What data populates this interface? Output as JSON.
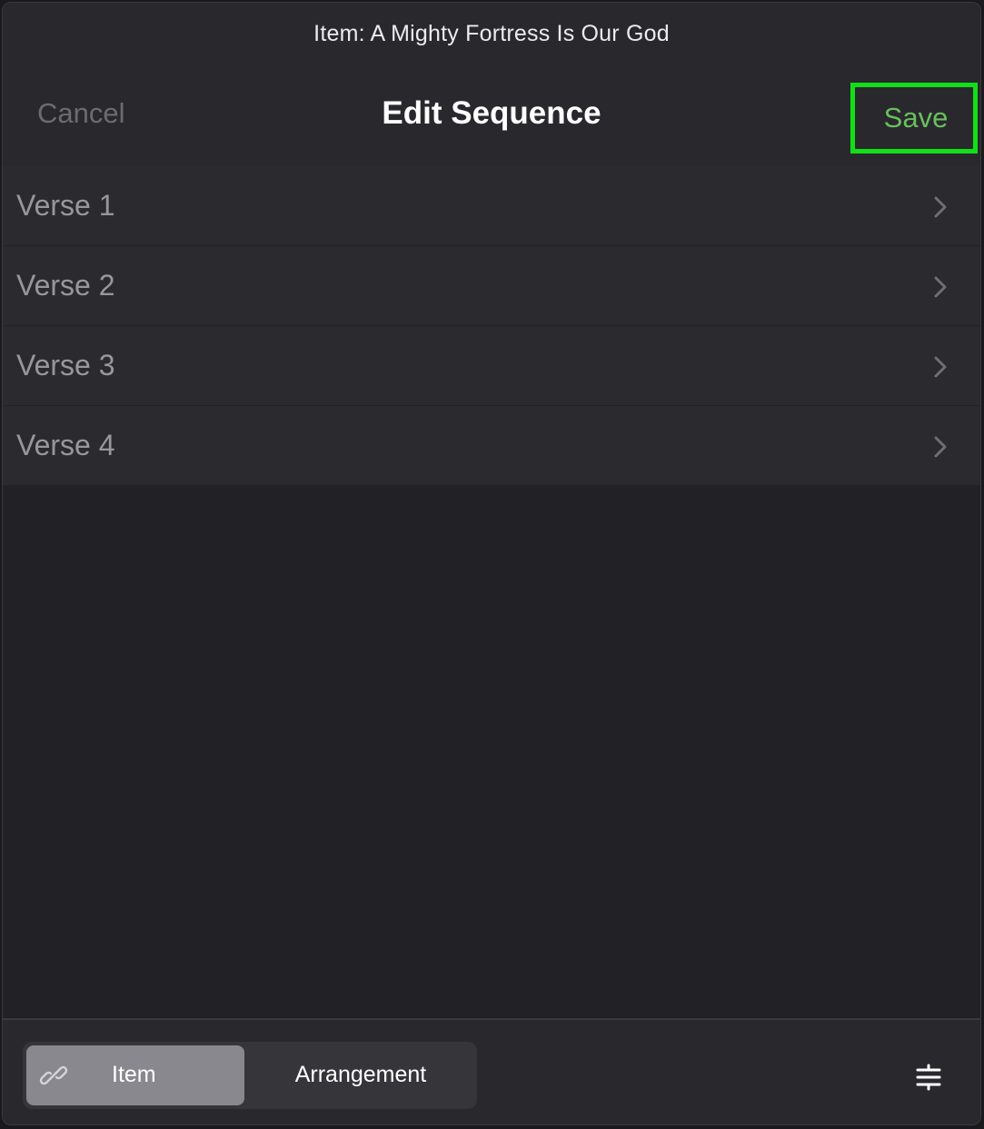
{
  "header": {
    "subtitle": "Item: A Mighty Fortress Is Our God",
    "title": "Edit Sequence",
    "cancel_label": "Cancel",
    "save_label": "Save"
  },
  "sections": [
    {
      "label": "Verse 1",
      "icon": "chevron-right-icon"
    },
    {
      "label": "Verse 2",
      "icon": "chevron-right-icon"
    },
    {
      "label": "Verse 3",
      "icon": "chevron-right-icon"
    },
    {
      "label": "Verse 4",
      "icon": "chevron-right-icon"
    }
  ],
  "bottom_bar": {
    "segments": [
      {
        "label": "Item",
        "icon": "link-icon",
        "selected": true
      },
      {
        "label": "Arrangement",
        "selected": false
      }
    ],
    "options_icon": "sliders-icon"
  },
  "colors": {
    "background": "#222226",
    "header": "#29292d",
    "row": "#2b2b2f",
    "save_text": "#6abf5e",
    "save_highlight": "#11e018",
    "cancel_text": "#6c6c70",
    "selected_segment": "#88888e"
  }
}
